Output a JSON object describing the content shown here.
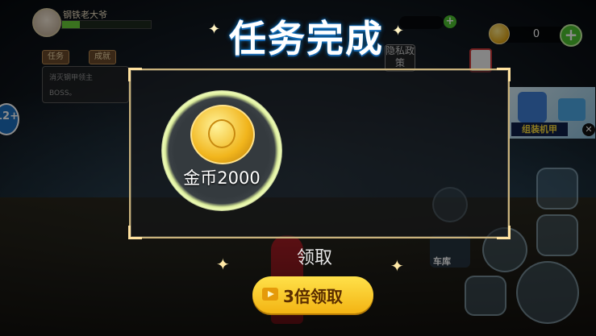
{
  "player": {
    "name": "钢铁老大爷",
    "hp_fraction": 0.2
  },
  "tabs": {
    "task": "任务",
    "achievement": "成就"
  },
  "task_panel": {
    "line1": "消灭钢甲领主",
    "line2": "BOSS。"
  },
  "age_badge": "12+",
  "currency": {
    "coins": "0"
  },
  "privacy_button": "隐私政策",
  "ad": {
    "label": "组装机甲",
    "close": "✕"
  },
  "dialog": {
    "title": "任务完成",
    "reward_label": "金币2000",
    "claim_label": "领取",
    "claim_triple_label": "3倍领取"
  },
  "car_label": "车库",
  "icons": {
    "plus": "+",
    "coin": "coin-icon",
    "video": "video-icon"
  }
}
